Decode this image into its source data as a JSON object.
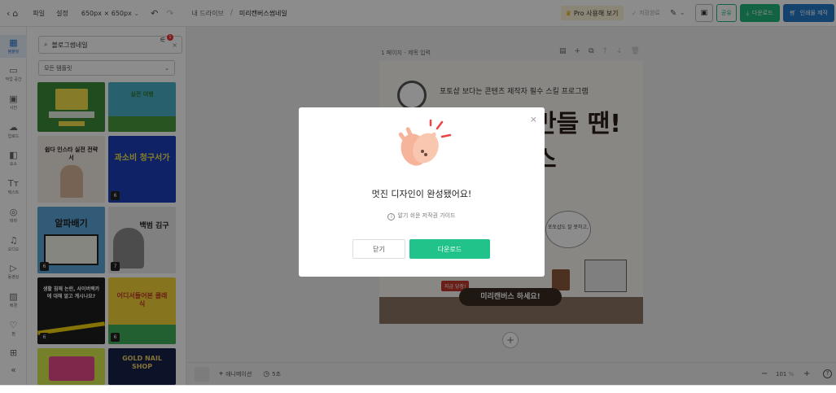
{
  "topbar": {
    "file_label": "파일",
    "settings_label": "설정",
    "size_label": "650px × 650px",
    "breadcrumb_root": "내 드라이브",
    "breadcrumb_sep": "/",
    "doc_title": "미리캔버스썸네일",
    "pro_label": "Pro 사용해 보기",
    "saved_label": "저장완료",
    "share_label": "공유",
    "download_label": "다운로드",
    "print_label": "인쇄물 제작"
  },
  "rail": {
    "items": [
      {
        "label": "템플릿",
        "icon": "grid-icon"
      },
      {
        "label": "작업 공간",
        "icon": "box-icon"
      },
      {
        "label": "사진",
        "icon": "image-icon"
      },
      {
        "label": "업로드",
        "icon": "cloud-upload-icon"
      },
      {
        "label": "요소",
        "icon": "shapes-icon"
      },
      {
        "label": "텍스트",
        "icon": "text-icon"
      },
      {
        "label": "테마",
        "icon": "palette-icon"
      },
      {
        "label": "오디오",
        "icon": "music-icon"
      },
      {
        "label": "동영상",
        "icon": "play-icon"
      },
      {
        "label": "배경",
        "icon": "pattern-icon"
      },
      {
        "label": "찜",
        "icon": "heart-icon"
      },
      {
        "label": "",
        "icon": "more-icon"
      }
    ]
  },
  "panel": {
    "search_value": "블로그썸네일",
    "filter_count": "1",
    "category_value": "모든 템플릿",
    "templates": [
      {
        "badge": "",
        "text": ""
      },
      {
        "badge": "",
        "text": "실전 여행"
      },
      {
        "badge": "",
        "text": "쉽다 인스타 실전 전략서"
      },
      {
        "badge": "6",
        "text": "과소비 청구서가"
      },
      {
        "badge": "6",
        "text": "알파배기"
      },
      {
        "badge": "7",
        "text": "백범 김구"
      },
      {
        "badge": "6",
        "text": "생활 침해 논란, 사이버렉카에 대해 알고 계시나요?"
      },
      {
        "badge": "6",
        "text": "어디서들어본 클래식"
      },
      {
        "badge": "",
        "text": ""
      },
      {
        "badge": "",
        "text": "GOLD NAIL SHOP"
      }
    ]
  },
  "canvas": {
    "page_label": "1 페이지 - 제목 입력",
    "headline_top": "포토샵 보다는 콘텐츠 제작자 필수 스킬 프로그램",
    "headline_main": "만들 땐!",
    "headline_sub": "스",
    "bubble_text": "포토샵도 잘 못하고,",
    "tag_text": "지금 당장!",
    "cta_text": "미리캔버스 하세요!"
  },
  "bottombar": {
    "animation_label": "애니메이션",
    "time_label": "5초",
    "zoom_label": "101",
    "zoom_unit": "%"
  },
  "modal": {
    "title": "멋진 디자인이 완성됐어요!",
    "guide_label": "알기 쉬운 저작권 가이드",
    "close_label": "닫기",
    "download_label": "다운로드"
  },
  "colors": {
    "primary_green": "#21c38a",
    "brand_blue": "#2278c7",
    "cta_brown": "#3a2a22"
  }
}
